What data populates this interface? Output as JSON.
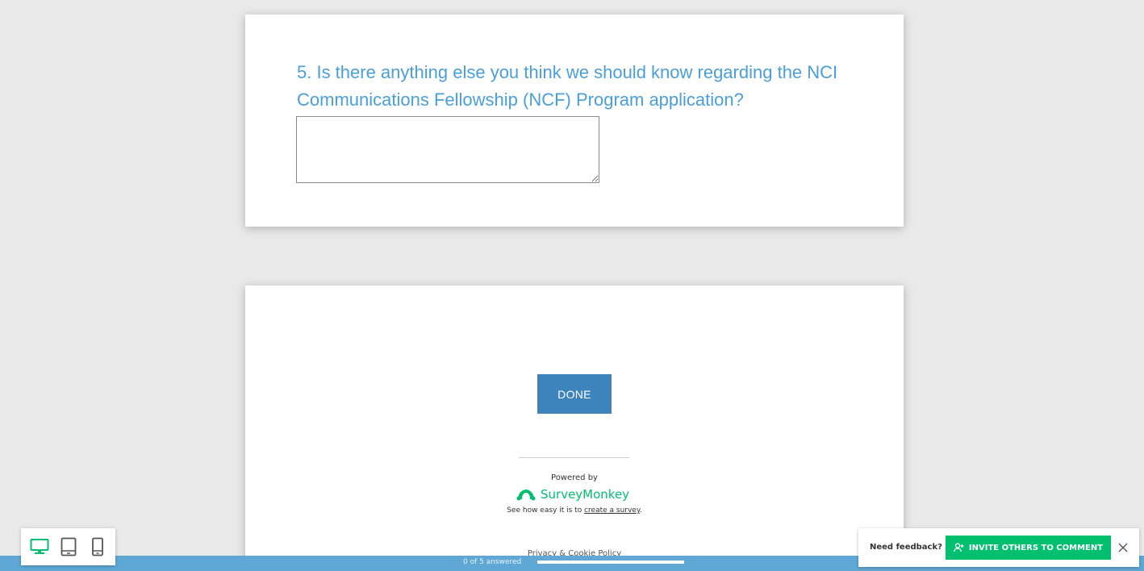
{
  "question": {
    "title": "5. Is there anything else you think we should know regarding the NCI Communications Fellowship (NCF) Program application?",
    "answer_value": ""
  },
  "footer": {
    "done_label": "DONE",
    "powered_by": "Powered by",
    "brand_name": "SurveyMonkey",
    "tagline_prefix": "See how easy it is to ",
    "tagline_link": "create a survey",
    "tagline_suffix": ".",
    "privacy_link": "Privacy & Cookie Policy"
  },
  "progress": {
    "text": "0 of 5 answered",
    "fraction": 0
  },
  "device_toolbar": {
    "items": [
      {
        "icon": "desktop-icon",
        "active": true
      },
      {
        "icon": "tablet-icon",
        "active": false
      },
      {
        "icon": "phone-icon",
        "active": false
      }
    ]
  },
  "feedback": {
    "label": "Need feedback?",
    "invite_label": "INVITE OTHERS TO COMMENT",
    "invite_icon": "user-add-icon",
    "close_icon": "close-icon"
  },
  "colors": {
    "accent_blue": "#4a9fd8",
    "button_blue": "#3d84bd",
    "brand_green": "#00bf6f",
    "progress_blue": "#5fa8d6"
  }
}
